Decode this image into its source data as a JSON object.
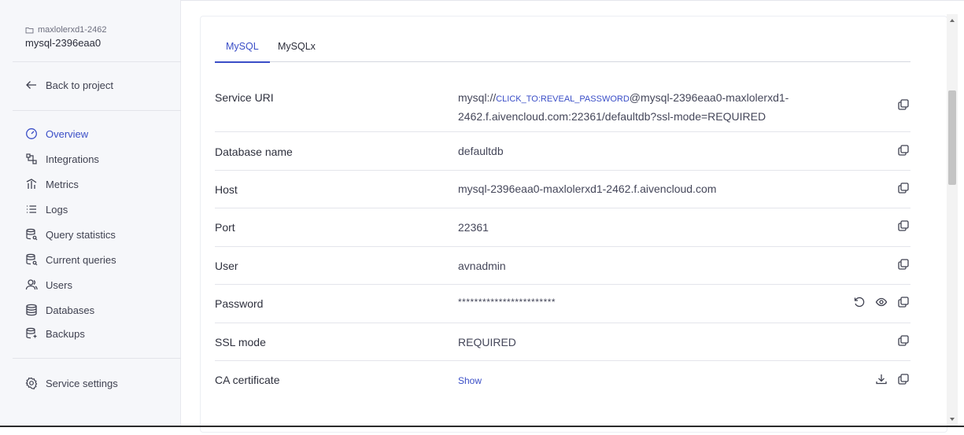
{
  "sidebar": {
    "project": "maxlolerxd1-2462",
    "service": "mysql-2396eaa0",
    "back_label": "Back to project",
    "nav": [
      {
        "label": "Overview",
        "icon": "gauge-icon",
        "active": true
      },
      {
        "label": "Integrations",
        "icon": "integrations-icon"
      },
      {
        "label": "Metrics",
        "icon": "metrics-icon"
      },
      {
        "label": "Logs",
        "icon": "logs-icon"
      },
      {
        "label": "Query statistics",
        "icon": "query-stats-icon"
      },
      {
        "label": "Current queries",
        "icon": "current-queries-icon"
      },
      {
        "label": "Users",
        "icon": "users-icon"
      },
      {
        "label": "Databases",
        "icon": "database-icon"
      },
      {
        "label": "Backups",
        "icon": "backups-icon"
      }
    ],
    "settings_label": "Service settings"
  },
  "tabs": [
    {
      "label": "MySQL",
      "active": true
    },
    {
      "label": "MySQLx"
    }
  ],
  "connection": {
    "service_uri": {
      "label": "Service URI",
      "prefix": "mysql://",
      "token": "CLICK_TO:REVEAL_PASSWORD",
      "suffix_line1": "@mysql-2396eaa0-maxlolerxd1-",
      "line2": "2462.f.aivencloud.com:22361/defaultdb?ssl-mode=REQUIRED"
    },
    "database_name": {
      "label": "Database name",
      "value": "defaultdb"
    },
    "host": {
      "label": "Host",
      "value": "mysql-2396eaa0-maxlolerxd1-2462.f.aivencloud.com"
    },
    "port": {
      "label": "Port",
      "value": "22361"
    },
    "user": {
      "label": "User",
      "value": "avnadmin"
    },
    "password": {
      "label": "Password",
      "value": "************************"
    },
    "ssl_mode": {
      "label": "SSL mode",
      "value": "REQUIRED"
    },
    "ca_certificate": {
      "label": "CA certificate",
      "value": "Show"
    }
  },
  "colors": {
    "accent": "#3a4ec7",
    "sidebar_bg": "#f6f7fa",
    "text": "#2e303d"
  }
}
